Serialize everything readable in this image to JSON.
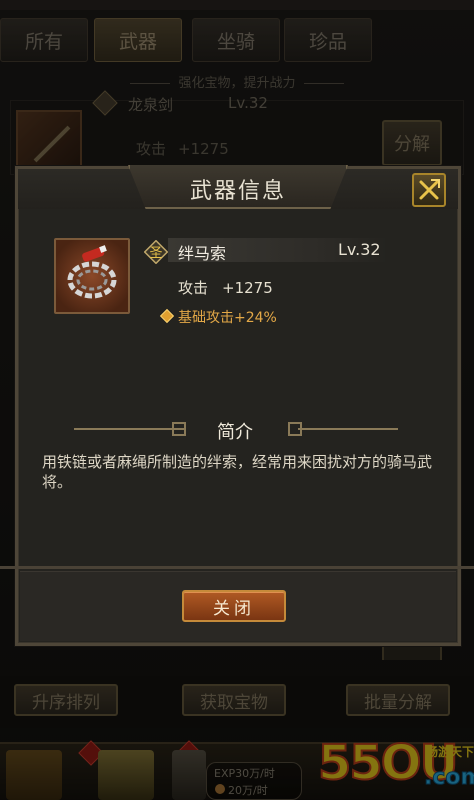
{
  "background": {
    "tabs": [
      {
        "label": "所有",
        "active": false
      },
      {
        "label": "武器",
        "active": true
      },
      {
        "label": "坐骑",
        "active": false
      },
      {
        "label": "珍品",
        "active": false
      }
    ],
    "hint": "强化宝物，提升战力",
    "list_item": {
      "name": "龙泉剑",
      "level": "Lv.32",
      "attack_label": "攻击",
      "attack_value": "+1275",
      "decompose_label": "分解"
    },
    "buttons": {
      "sort": "升序排列",
      "get": "获取宝物",
      "batch_decompose": "批量分解"
    },
    "exp_line": "EXP30万/时",
    "coin_line": "20万/时"
  },
  "modal": {
    "title": "武器信息",
    "item": {
      "rank_badge": "圣",
      "name": "绊马索",
      "level": "Lv.32",
      "attack_label": "攻击",
      "attack_value": "+1275",
      "bonus": "基础攻击+24%"
    },
    "intro_title": "简介",
    "intro_text": "用铁链或者麻绳所制造的绊索，经常用来困扰对方的骑马武将。",
    "close_button": "关闭"
  },
  "watermark": {
    "number": "55OU",
    "domain": ".com",
    "tagline": "畅游天下"
  },
  "colors": {
    "accent_gold": "#e3a847",
    "button_orange": "#b05a24",
    "panel_bg": "#24231f"
  }
}
